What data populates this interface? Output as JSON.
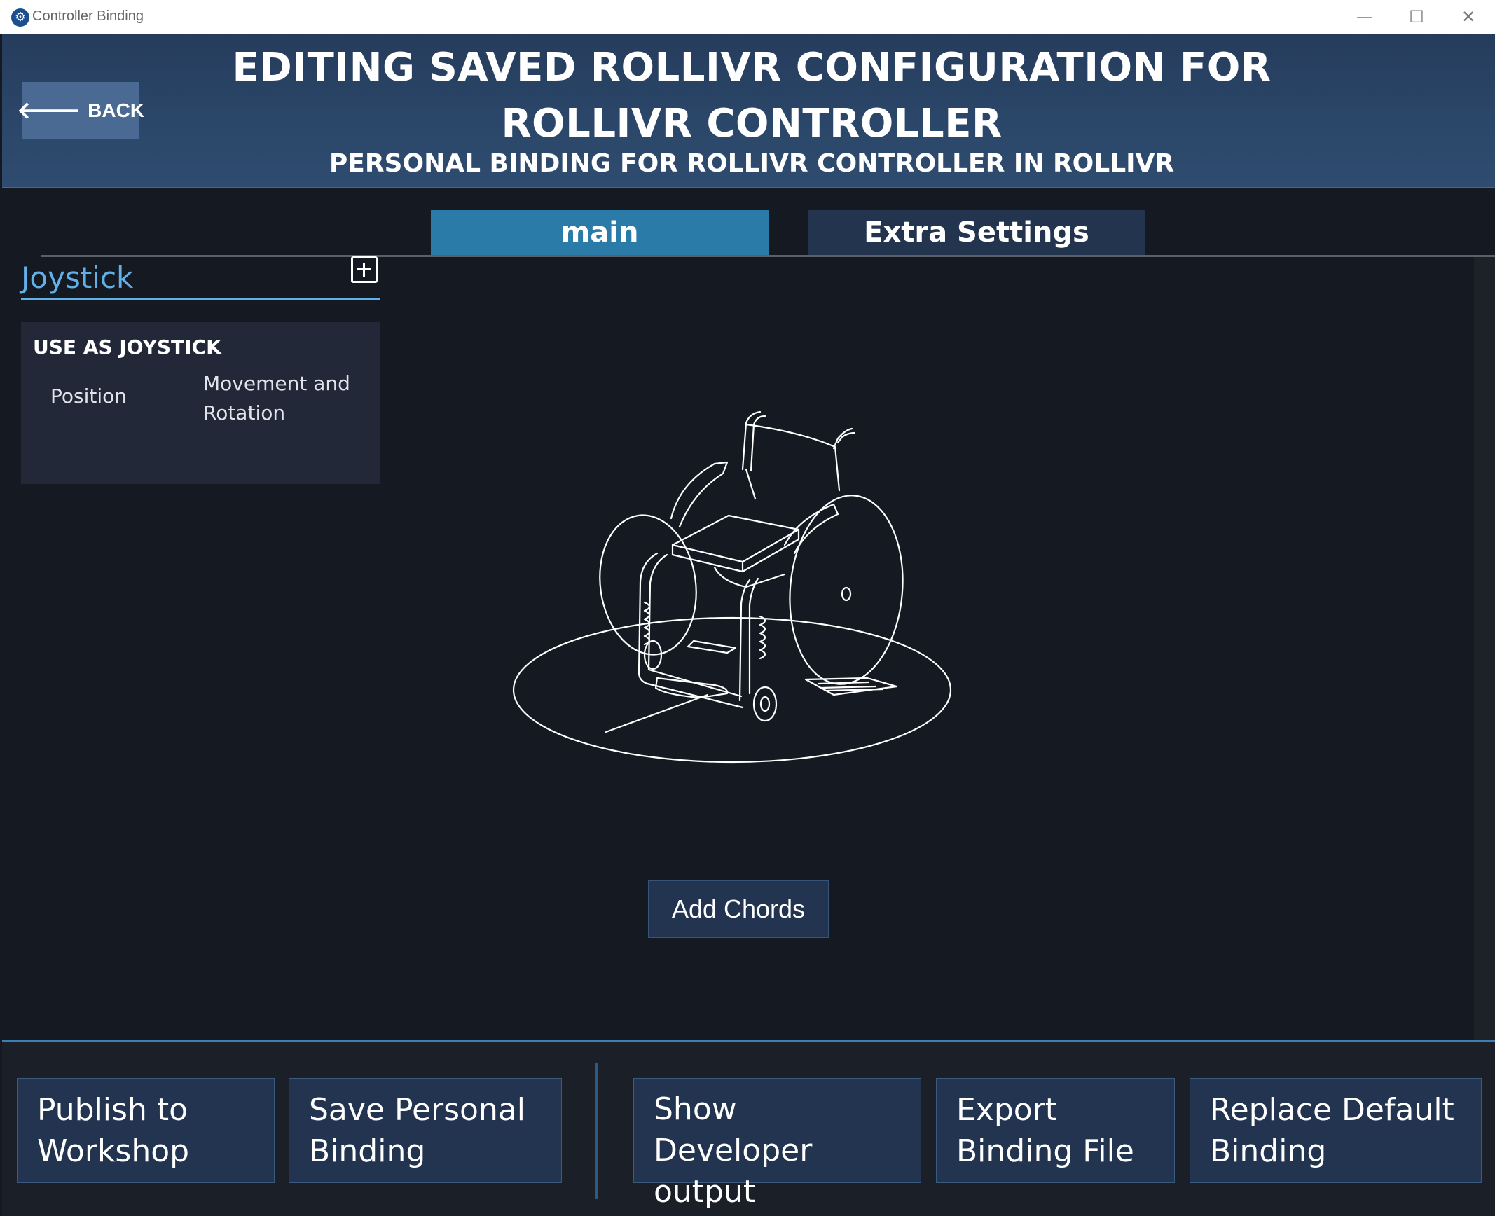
{
  "window": {
    "title": "Controller Binding",
    "controls": {
      "minimize": "—",
      "maximize": "☐",
      "close": "✕"
    }
  },
  "header": {
    "back_label": "BACK",
    "title": "EDITING SAVED ROLLIVR CONFIGURATION FOR ROLLIVR CONTROLLER",
    "subtitle": "PERSONAL BINDING FOR ROLLIVR CONTROLLER IN ROLLIVR"
  },
  "tabs": [
    {
      "label": "main",
      "active": true
    },
    {
      "label": "Extra Settings",
      "active": false
    }
  ],
  "left_panel": {
    "section_title": "Joystick",
    "mode_card": {
      "title": "USE AS JOYSTICK",
      "input_name": "Position",
      "input_action": "Movement and Rotation"
    }
  },
  "illustration": {
    "icon": "wheelchair-controller-icon"
  },
  "chords_label": "Add Chords",
  "bottom_buttons": [
    "Publish to Workshop",
    "Save Personal Binding",
    "Show Developer output",
    "Export Binding File",
    "Replace Default Binding"
  ],
  "colors": {
    "background": "#151a22",
    "header": "#2a4668",
    "active_tab": "#2a7ba8",
    "accent": "#62b0e8",
    "button": "#22344f"
  }
}
